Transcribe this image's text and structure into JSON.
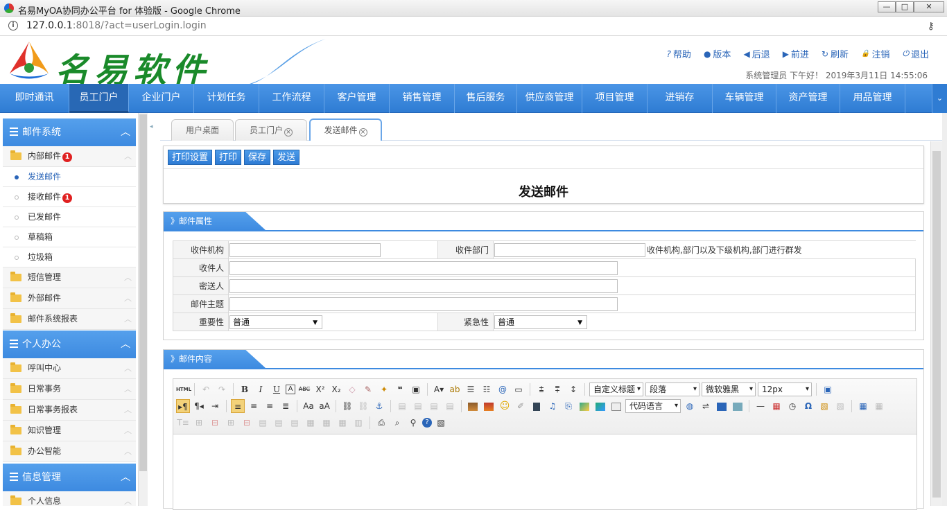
{
  "window": {
    "title": "名易MyOA协同办公平台 for 体验版 - Google Chrome",
    "min": "—",
    "max": "□",
    "close": "✕"
  },
  "address": {
    "host": "127.0.0.1",
    "rest": ":8018/?act=userLogin.login"
  },
  "logo": {
    "name": "名易软件"
  },
  "toplinks": [
    {
      "icon": "help-icon",
      "glyph": "?",
      "label": "帮助"
    },
    {
      "icon": "info-icon",
      "glyph": "●",
      "label": "版本"
    },
    {
      "icon": "back-icon",
      "glyph": "◀",
      "label": "后退"
    },
    {
      "icon": "forward-icon",
      "glyph": "▶",
      "label": "前进"
    },
    {
      "icon": "refresh-icon",
      "glyph": "↻",
      "label": "刷新"
    },
    {
      "icon": "lock-icon",
      "glyph": "🔒",
      "label": "注销"
    },
    {
      "icon": "power-icon",
      "glyph": "⏻",
      "label": "退出"
    }
  ],
  "user_line": "系统管理员 下午好！ 2019年3月11日 14:55:06",
  "nav": [
    "即时通讯",
    "员工门户",
    "企业门户",
    "计划任务",
    "工作流程",
    "客户管理",
    "销售管理",
    "售后服务",
    "供应商管理",
    "项目管理",
    "进销存",
    "车辆管理",
    "资产管理",
    "用品管理"
  ],
  "nav_active": "员工门户",
  "sidebar": {
    "sections": [
      {
        "title": "邮件系统"
      },
      {
        "title": "个人办公"
      },
      {
        "title": "信息管理"
      }
    ],
    "mail": {
      "inbox_group": "内部邮件",
      "inbox_badge": "1",
      "sub": [
        "发送邮件",
        "接收邮件",
        "已发邮件",
        "草稿箱",
        "垃圾箱"
      ],
      "receive_badge": "1",
      "groups": [
        "短信管理",
        "外部邮件",
        "邮件系统报表"
      ]
    },
    "office": [
      "呼叫中心",
      "日常事务",
      "日常事务报表",
      "知识管理",
      "办公智能"
    ],
    "info": [
      "个人信息"
    ]
  },
  "tabs": [
    "用户桌面",
    "员工门户",
    "发送邮件"
  ],
  "actions": [
    "打印设置",
    "打印",
    "保存",
    "发送"
  ],
  "page_title": "发送邮件",
  "attrs": {
    "header": "》邮件属性",
    "recv_org": "收件机构",
    "recv_dept": "收件部门",
    "dept_hint": "收件机构,部门以及下级机构,部门进行群发",
    "recipient": "收件人",
    "cc": "密送人",
    "subject": "邮件主题",
    "importance": "重要性",
    "importance_val": "普通",
    "urgency": "紧急性",
    "urgency_val": "普通"
  },
  "content": {
    "header": "》邮件内容",
    "heading_select": "自定义标题",
    "para_select": "段落",
    "font_select": "微软雅黑",
    "size_select": "12px",
    "code_select": "代码语言"
  }
}
